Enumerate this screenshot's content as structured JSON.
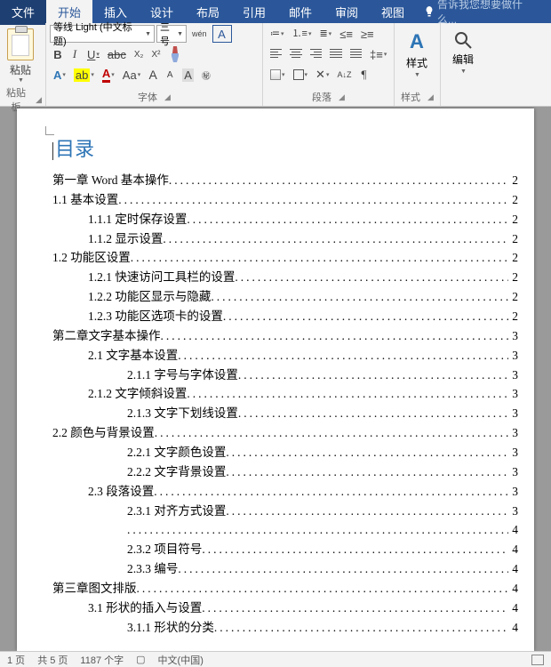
{
  "tabs": {
    "file": "文件",
    "home": "开始",
    "insert": "插入",
    "design": "设计",
    "layout": "布局",
    "references": "引用",
    "mailings": "邮件",
    "review": "审阅",
    "view": "视图",
    "tellme": "告诉我您想要做什么..."
  },
  "ribbon": {
    "clipboard": {
      "paste": "粘贴",
      "label": "粘贴板"
    },
    "font": {
      "name": "等线 Light (中文标题)",
      "size": "三号",
      "wen": "wén",
      "A_boxed": "A",
      "bold": "B",
      "italic": "I",
      "underline": "U",
      "strike": "abc",
      "sub": "X₂",
      "sup": "X²",
      "textfx": "A",
      "highlight": "ab",
      "fontcolor": "A",
      "scale": "Aa",
      "grow": "A",
      "shrink": "A",
      "change_case": "A",
      "clear": "Aₐ",
      "label": "字体"
    },
    "para": {
      "line_spacing": "",
      "sort": "A↓Z",
      "pilcrow": "¶",
      "label": "段落"
    },
    "styles": {
      "btn": "样式",
      "label": "样式"
    },
    "editing": {
      "btn": "编辑"
    }
  },
  "toc": {
    "title": "目录",
    "entries": [
      {
        "lvl": 0,
        "t": "第一章 Word 基本操作",
        "p": "2"
      },
      {
        "lvl": 0,
        "t": "1.1 基本设置",
        "p": "2"
      },
      {
        "lvl": 1,
        "t": "1.1.1 定时保存设置",
        "p": "2"
      },
      {
        "lvl": 1,
        "t": "1.1.2 显示设置",
        "p": "2"
      },
      {
        "lvl": 0,
        "t": "1.2 功能区设置",
        "p": "2"
      },
      {
        "lvl": 1,
        "t": "1.2.1 快速访问工具栏的设置",
        "p": "2"
      },
      {
        "lvl": 1,
        "t": "1.2.2 功能区显示与隐藏",
        "p": "2"
      },
      {
        "lvl": 1,
        "t": "1.2.3 功能区选项卡的设置",
        "p": "2"
      },
      {
        "lvl": 0,
        "t": "第二章文字基本操作",
        "p": "3"
      },
      {
        "lvl": 1,
        "t": "2.1 文字基本设置",
        "p": "3"
      },
      {
        "lvl": 2,
        "t": "2.1.1 字号与字体设置",
        "p": "3"
      },
      {
        "lvl": 1,
        "t": "2.1.2 文字倾斜设置",
        "p": "3"
      },
      {
        "lvl": 2,
        "t": "2.1.3 文字下划线设置",
        "p": "3"
      },
      {
        "lvl": 0,
        "t": "2.2 颜色与背景设置",
        "p": "3"
      },
      {
        "lvl": 2,
        "t": "2.2.1 文字颜色设置",
        "p": "3"
      },
      {
        "lvl": 2,
        "t": "2.2.2 文字背景设置",
        "p": "3"
      },
      {
        "lvl": 1,
        "t": "2.3 段落设置",
        "p": "3"
      },
      {
        "lvl": 2,
        "t": "2.3.1 对齐方式设置",
        "p": "3"
      },
      {
        "lvl": 2,
        "t": "",
        "p": "4"
      },
      {
        "lvl": 2,
        "t": "2.3.2 项目符号",
        "p": "4"
      },
      {
        "lvl": 2,
        "t": "2.3.3 编号",
        "p": "4"
      },
      {
        "lvl": 0,
        "t": "第三章图文排版",
        "p": "4"
      },
      {
        "lvl": 1,
        "t": "3.1 形状的插入与设置",
        "p": "4"
      },
      {
        "lvl": 2,
        "t": "3.1.1 形状的分类",
        "p": "4"
      }
    ]
  },
  "status": {
    "page": "1 页",
    "total": "共 5 页",
    "words": "1187 个字",
    "lang": "中文(中国)"
  }
}
